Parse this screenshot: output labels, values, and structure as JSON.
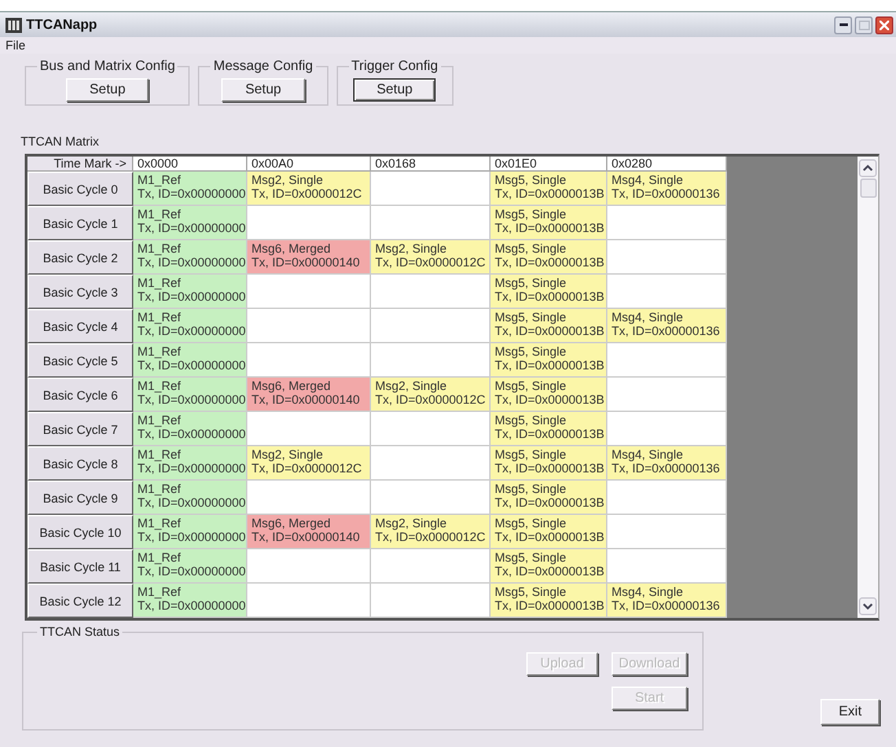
{
  "window": {
    "title": "TTCANapp"
  },
  "menu": [
    {
      "label": "File"
    }
  ],
  "config_groups": [
    {
      "title": "Bus and Matrix Config",
      "button": "Setup",
      "focused": false
    },
    {
      "title": "Message Config",
      "button": "Setup",
      "focused": false
    },
    {
      "title": "Trigger Config",
      "button": "Setup",
      "focused": true
    }
  ],
  "matrix": {
    "title": "TTCAN Matrix",
    "corner": "Time Mark ->",
    "columns": [
      "0x0000",
      "0x00A0",
      "0x0168",
      "0x01E0",
      "0x0280"
    ],
    "rows": [
      {
        "label": "Basic Cycle 0",
        "cells": [
          {
            "kind": "ref",
            "name": "M1_Ref",
            "tx": "Tx, ID=0x00000000"
          },
          {
            "kind": "single",
            "name": "Msg2, Single",
            "tx": "Tx, ID=0x0000012C"
          },
          {
            "kind": "empty"
          },
          {
            "kind": "single",
            "name": "Msg5, Single",
            "tx": "Tx, ID=0x0000013B"
          },
          {
            "kind": "single",
            "name": "Msg4, Single",
            "tx": "Tx, ID=0x00000136"
          }
        ]
      },
      {
        "label": "Basic Cycle 1",
        "cells": [
          {
            "kind": "ref",
            "name": "M1_Ref",
            "tx": "Tx, ID=0x00000000"
          },
          {
            "kind": "empty"
          },
          {
            "kind": "empty"
          },
          {
            "kind": "single",
            "name": "Msg5, Single",
            "tx": "Tx, ID=0x0000013B"
          },
          {
            "kind": "empty"
          }
        ]
      },
      {
        "label": "Basic Cycle 2",
        "cells": [
          {
            "kind": "ref",
            "name": "M1_Ref",
            "tx": "Tx, ID=0x00000000"
          },
          {
            "kind": "merged",
            "name": "Msg6, Merged",
            "tx": "Tx, ID=0x00000140"
          },
          {
            "kind": "single",
            "name": "Msg2, Single",
            "tx": "Tx, ID=0x0000012C"
          },
          {
            "kind": "single",
            "name": "Msg5, Single",
            "tx": "Tx, ID=0x0000013B"
          },
          {
            "kind": "empty"
          }
        ]
      },
      {
        "label": "Basic Cycle 3",
        "cells": [
          {
            "kind": "ref",
            "name": "M1_Ref",
            "tx": "Tx, ID=0x00000000"
          },
          {
            "kind": "empty"
          },
          {
            "kind": "empty"
          },
          {
            "kind": "single",
            "name": "Msg5, Single",
            "tx": "Tx, ID=0x0000013B"
          },
          {
            "kind": "empty"
          }
        ]
      },
      {
        "label": "Basic Cycle 4",
        "cells": [
          {
            "kind": "ref",
            "name": "M1_Ref",
            "tx": "Tx, ID=0x00000000"
          },
          {
            "kind": "empty"
          },
          {
            "kind": "empty"
          },
          {
            "kind": "single",
            "name": "Msg5, Single",
            "tx": "Tx, ID=0x0000013B"
          },
          {
            "kind": "single",
            "name": "Msg4, Single",
            "tx": "Tx, ID=0x00000136"
          }
        ]
      },
      {
        "label": "Basic Cycle 5",
        "cells": [
          {
            "kind": "ref",
            "name": "M1_Ref",
            "tx": "Tx, ID=0x00000000"
          },
          {
            "kind": "empty"
          },
          {
            "kind": "empty"
          },
          {
            "kind": "single",
            "name": "Msg5, Single",
            "tx": "Tx, ID=0x0000013B"
          },
          {
            "kind": "empty"
          }
        ]
      },
      {
        "label": "Basic Cycle 6",
        "cells": [
          {
            "kind": "ref",
            "name": "M1_Ref",
            "tx": "Tx, ID=0x00000000"
          },
          {
            "kind": "merged",
            "name": "Msg6, Merged",
            "tx": "Tx, ID=0x00000140"
          },
          {
            "kind": "single",
            "name": "Msg2, Single",
            "tx": "Tx, ID=0x0000012C"
          },
          {
            "kind": "single",
            "name": "Msg5, Single",
            "tx": "Tx, ID=0x0000013B"
          },
          {
            "kind": "empty"
          }
        ]
      },
      {
        "label": "Basic Cycle 7",
        "cells": [
          {
            "kind": "ref",
            "name": "M1_Ref",
            "tx": "Tx, ID=0x00000000"
          },
          {
            "kind": "empty"
          },
          {
            "kind": "empty"
          },
          {
            "kind": "single",
            "name": "Msg5, Single",
            "tx": "Tx, ID=0x0000013B"
          },
          {
            "kind": "empty"
          }
        ]
      },
      {
        "label": "Basic Cycle 8",
        "cells": [
          {
            "kind": "ref",
            "name": "M1_Ref",
            "tx": "Tx, ID=0x00000000"
          },
          {
            "kind": "single",
            "name": "Msg2, Single",
            "tx": "Tx, ID=0x0000012C"
          },
          {
            "kind": "empty"
          },
          {
            "kind": "single",
            "name": "Msg5, Single",
            "tx": "Tx, ID=0x0000013B"
          },
          {
            "kind": "single",
            "name": "Msg4, Single",
            "tx": "Tx, ID=0x00000136"
          }
        ]
      },
      {
        "label": "Basic Cycle 9",
        "cells": [
          {
            "kind": "ref",
            "name": "M1_Ref",
            "tx": "Tx, ID=0x00000000"
          },
          {
            "kind": "empty"
          },
          {
            "kind": "empty"
          },
          {
            "kind": "single",
            "name": "Msg5, Single",
            "tx": "Tx, ID=0x0000013B"
          },
          {
            "kind": "empty"
          }
        ]
      },
      {
        "label": "Basic Cycle 10",
        "cells": [
          {
            "kind": "ref",
            "name": "M1_Ref",
            "tx": "Tx, ID=0x00000000"
          },
          {
            "kind": "merged",
            "name": "Msg6, Merged",
            "tx": "Tx, ID=0x00000140"
          },
          {
            "kind": "single",
            "name": "Msg2, Single",
            "tx": "Tx, ID=0x0000012C"
          },
          {
            "kind": "single",
            "name": "Msg5, Single",
            "tx": "Tx, ID=0x0000013B"
          },
          {
            "kind": "empty"
          }
        ]
      },
      {
        "label": "Basic Cycle 11",
        "cells": [
          {
            "kind": "ref",
            "name": "M1_Ref",
            "tx": "Tx, ID=0x00000000"
          },
          {
            "kind": "empty"
          },
          {
            "kind": "empty"
          },
          {
            "kind": "single",
            "name": "Msg5, Single",
            "tx": "Tx, ID=0x0000013B"
          },
          {
            "kind": "empty"
          }
        ]
      },
      {
        "label": "Basic Cycle 12",
        "cells": [
          {
            "kind": "ref",
            "name": "M1_Ref",
            "tx": "Tx, ID=0x00000000"
          },
          {
            "kind": "empty"
          },
          {
            "kind": "empty"
          },
          {
            "kind": "single",
            "name": "Msg5, Single",
            "tx": "Tx, ID=0x0000013B"
          },
          {
            "kind": "single",
            "name": "Msg4, Single",
            "tx": "Tx, ID=0x00000136"
          }
        ]
      }
    ]
  },
  "status": {
    "title": "TTCAN Status",
    "buttons": [
      {
        "label": "Upload",
        "disabled": true
      },
      {
        "label": "Download",
        "disabled": true
      },
      {
        "label": "Start",
        "disabled": true
      }
    ]
  },
  "exit_button": {
    "label": "Exit",
    "disabled": false
  }
}
